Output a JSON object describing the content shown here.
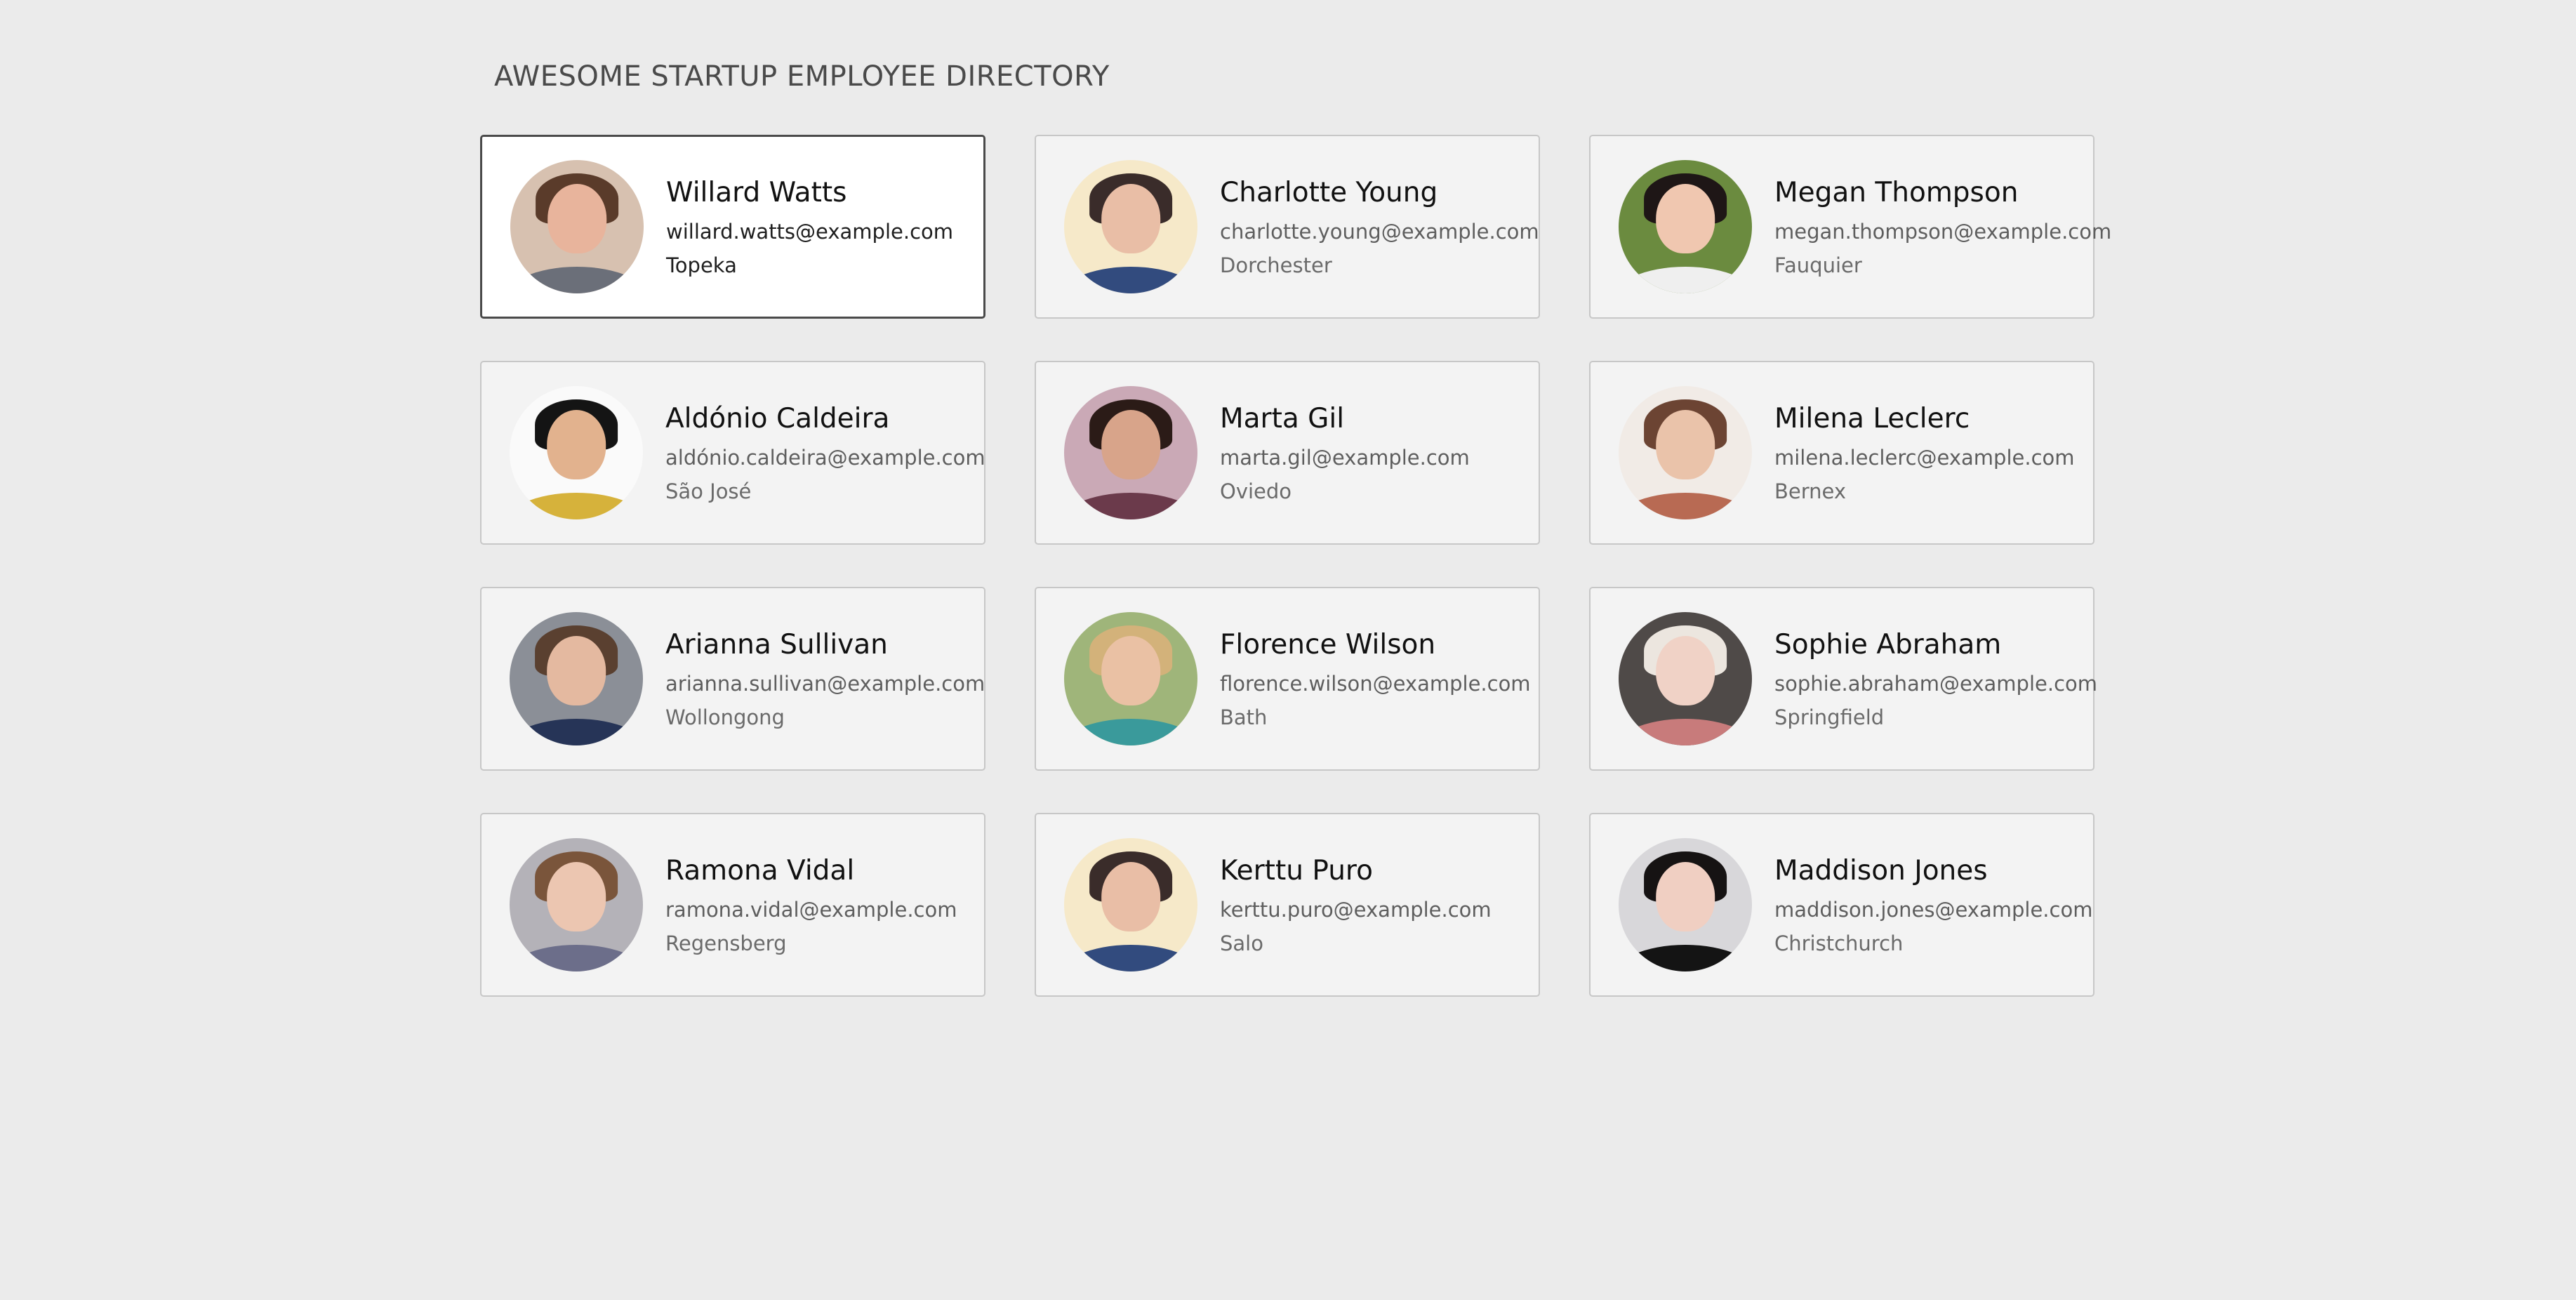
{
  "header": {
    "title": "AWESOME STARTUP EMPLOYEE DIRECTORY"
  },
  "employees": [
    {
      "name": "Willard Watts",
      "email": "willard.watts@example.com",
      "city": "Topeka",
      "avatar_bg": "#d7c1b0",
      "avatar_face": "#e8b49c",
      "avatar_hair": "#5a3b2a",
      "avatar_shirt": "#6b6f79"
    },
    {
      "name": "Charlotte Young",
      "email": "charlotte.young@example.com",
      "city": "Dorchester",
      "avatar_bg": "#f6e9c9",
      "avatar_face": "#e9bea6",
      "avatar_hair": "#3a2c2a",
      "avatar_shirt": "#324b7e"
    },
    {
      "name": "Megan Thompson",
      "email": "megan.thompson@example.com",
      "city": "Fauquier",
      "avatar_bg": "#6b8b3f",
      "avatar_face": "#f0c7b0",
      "avatar_hair": "#1e1616",
      "avatar_shirt": "#efefef"
    },
    {
      "name": "Aldónio Caldeira",
      "email": "aldónio.caldeira@example.com",
      "city": "São José",
      "avatar_bg": "#fafafa",
      "avatar_face": "#e2b28e",
      "avatar_hair": "#141414",
      "avatar_shirt": "#d6b23b"
    },
    {
      "name": "Marta Gil",
      "email": "marta.gil@example.com",
      "city": "Oviedo",
      "avatar_bg": "#caa9b6",
      "avatar_face": "#d8a48a",
      "avatar_hair": "#2b1b17",
      "avatar_shirt": "#6b3a4b"
    },
    {
      "name": "Milena Leclerc",
      "email": "milena.leclerc@example.com",
      "city": "Bernex",
      "avatar_bg": "#f1ebe6",
      "avatar_face": "#eac3aa",
      "avatar_hair": "#6c4433",
      "avatar_shirt": "#b86a53"
    },
    {
      "name": "Arianna Sullivan",
      "email": "arianna.sullivan@example.com",
      "city": "Wollongong",
      "avatar_bg": "#8b8f97",
      "avatar_face": "#e4b9a0",
      "avatar_hair": "#5a4030",
      "avatar_shirt": "#263457"
    },
    {
      "name": "Florence Wilson",
      "email": "florence.wilson@example.com",
      "city": "Bath",
      "avatar_bg": "#9fb57a",
      "avatar_face": "#eac1a4",
      "avatar_hair": "#d3b27a",
      "avatar_shirt": "#3a9a9b"
    },
    {
      "name": "Sophie Abraham",
      "email": "sophie.abraham@example.com",
      "city": "Springfield",
      "avatar_bg": "#4f4a48",
      "avatar_face": "#f0d2c6",
      "avatar_hair": "#ece6df",
      "avatar_shirt": "#c87b7b"
    },
    {
      "name": "Ramona Vidal",
      "email": "ramona.vidal@example.com",
      "city": "Regensberg",
      "avatar_bg": "#b4b2b8",
      "avatar_face": "#ecc6b1",
      "avatar_hair": "#7a553b",
      "avatar_shirt": "#6c6e8a"
    },
    {
      "name": "Kerttu Puro",
      "email": "kerttu.puro@example.com",
      "city": "Salo",
      "avatar_bg": "#f6e9c9",
      "avatar_face": "#e9bea6",
      "avatar_hair": "#3a2c2a",
      "avatar_shirt": "#324b7e"
    },
    {
      "name": "Maddison Jones",
      "email": "maddison.jones@example.com",
      "city": "Christchurch",
      "avatar_bg": "#d8d7da",
      "avatar_face": "#f0cfc2",
      "avatar_hair": "#161313",
      "avatar_shirt": "#141414"
    }
  ]
}
